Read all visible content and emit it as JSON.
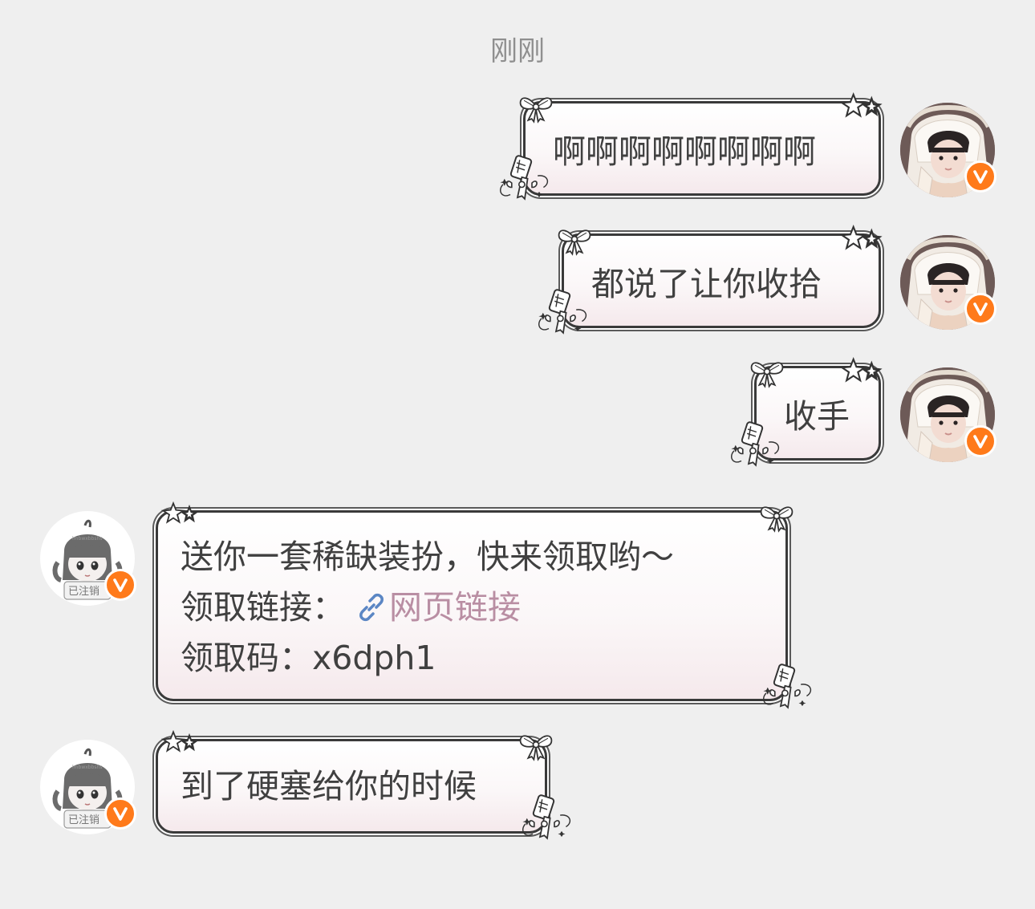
{
  "timestamp": "刚刚",
  "messages": [
    {
      "side": "right",
      "text": "啊啊啊啊啊啊啊啊"
    },
    {
      "side": "right",
      "text": "都说了让你收拾"
    },
    {
      "side": "right",
      "text": "收手"
    },
    {
      "side": "left",
      "lines": {
        "line1": "送你一套稀缺装扮，快来领取哟～",
        "line2_prefix": "领取链接：",
        "link_text": "网页链接",
        "line3": "领取码：x6dph1"
      }
    },
    {
      "side": "left",
      "text": "到了硬塞给你的时候"
    }
  ],
  "avatars": {
    "self_badge": "v-verified-icon",
    "other_avatar_text": "已注销"
  },
  "colors": {
    "background": "#efefef",
    "badge": "#ff7a1a",
    "link": "#b98ea3",
    "link_icon": "#5b86c4",
    "text": "#404040"
  }
}
